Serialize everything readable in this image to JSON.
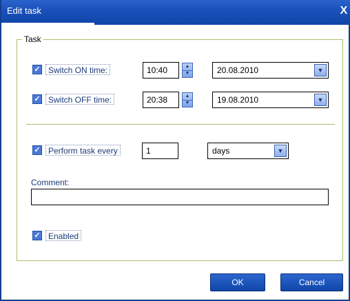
{
  "window": {
    "title": "Edit task",
    "close_label": "X"
  },
  "task_group": {
    "legend": "Task"
  },
  "switch_on": {
    "checked": true,
    "label": "Switch ON time:",
    "time": "10:40",
    "date": "20.08.2010"
  },
  "switch_off": {
    "checked": true,
    "label": "Switch OFF time:",
    "time": "20:38",
    "date": "19.08.2010"
  },
  "perform": {
    "checked": true,
    "label": "Perform task every",
    "interval": "1",
    "unit": "days"
  },
  "comment": {
    "label": "Comment:",
    "value": ""
  },
  "enabled": {
    "checked": true,
    "label": "Enabled"
  },
  "buttons": {
    "ok_label": "OK",
    "cancel_label": "Cancel"
  },
  "colors": {
    "accent": "#1950b8",
    "group_border": "#a8bf6e",
    "label_text": "#1a3a78"
  }
}
